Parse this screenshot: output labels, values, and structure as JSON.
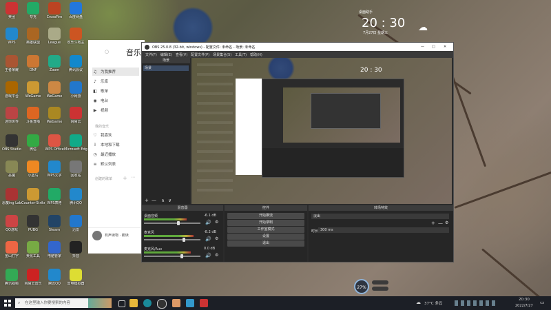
{
  "desktop": {
    "icons": [
      {
        "label": "美团",
        "color": "#c33"
      },
      {
        "label": "夸克",
        "color": "#2a6"
      },
      {
        "label": "CrossFire",
        "color": "#b42"
      },
      {
        "label": "百度网盘",
        "color": "#27d"
      },
      {
        "label": "WPS",
        "color": "#28c"
      },
      {
        "label": "英雄联盟",
        "color": "#a62"
      },
      {
        "label": "League",
        "color": "#aa8"
      },
      {
        "label": "欢乐斗地主",
        "color": "#c52"
      },
      {
        "label": "王者荣耀",
        "color": "#a53"
      },
      {
        "label": "DNF",
        "color": "#c73"
      },
      {
        "label": "Zoom",
        "color": "#2a8"
      },
      {
        "label": "腾讯会议",
        "color": "#18c"
      },
      {
        "label": "游戏平台",
        "color": "#a60"
      },
      {
        "label": "WeGame",
        "color": "#c93"
      },
      {
        "label": "WeGame",
        "color": "#c84"
      },
      {
        "label": "小网游",
        "color": "#27c"
      },
      {
        "label": "迷你世界",
        "color": "#b44"
      },
      {
        "label": "斗鱼直播",
        "color": "#d62"
      },
      {
        "label": "WeGame",
        "color": "#a82"
      },
      {
        "label": "网易云",
        "color": "#c33"
      },
      {
        "label": "OBS Studio",
        "color": "#333"
      },
      {
        "label": "微信",
        "color": "#3a4"
      },
      {
        "label": "WPS Office",
        "color": "#d54"
      },
      {
        "label": "Microsoft Edge",
        "color": "#1a8"
      },
      {
        "label": "恶魔",
        "color": "#885"
      },
      {
        "label": "小蓝鸟",
        "color": "#e82"
      },
      {
        "label": "WPS文字",
        "color": "#28c"
      },
      {
        "label": "回收站",
        "color": "#777"
      },
      {
        "label": "恶魔ing Lab",
        "color": "#a33"
      },
      {
        "label": "Counter-Strike",
        "color": "#c93"
      },
      {
        "label": "WPS表格",
        "color": "#2a6"
      },
      {
        "label": "腾讯QQ",
        "color": "#28c"
      },
      {
        "label": "QQ游戏",
        "color": "#c44"
      },
      {
        "label": "PUBG",
        "color": "#333"
      },
      {
        "label": "Steam",
        "color": "#246"
      },
      {
        "label": "迅雷",
        "color": "#27c"
      },
      {
        "label": "金山打字",
        "color": "#e64"
      },
      {
        "label": "美化工具",
        "color": "#7a4"
      },
      {
        "label": "电脑管家",
        "color": "#36c"
      },
      {
        "label": "抖音",
        "color": "#222"
      },
      {
        "label": "腾讯视频",
        "color": "#3a5"
      },
      {
        "label": "网易云音乐",
        "color": "#c22"
      },
      {
        "label": "腾讯QQ",
        "color": "#28c"
      },
      {
        "label": "雷电模拟器",
        "color": "#dd3"
      }
    ]
  },
  "widget": {
    "header": "桌面助手",
    "time": "20 : 30",
    "date": "7月27日 星期三"
  },
  "music": {
    "title": "音乐",
    "menu": [
      {
        "icon": "♫",
        "label": "为我推荐"
      },
      {
        "icon": "♪",
        "label": "乐库"
      },
      {
        "icon": "◧",
        "label": "歌单"
      },
      {
        "icon": "◉",
        "label": "电台"
      },
      {
        "icon": "▶",
        "label": "视频"
      }
    ],
    "section1": "我的音乐",
    "menu2": [
      {
        "icon": "♡",
        "label": "我喜欢"
      },
      {
        "icon": "⇩",
        "label": "本地和下载"
      },
      {
        "icon": "◷",
        "label": "最近播放"
      },
      {
        "icon": "≡",
        "label": "默认列表"
      }
    ],
    "section2": "创建的歌单",
    "now_playing": "有声读物 · 朗读"
  },
  "obs": {
    "title": "OBS 25.0.8 (32-bit, windows) - 配置文件: 未命名 - 场景: 未命名",
    "menu": [
      "文件(F)",
      "编辑(E)",
      "查看(V)",
      "配置文件(P)",
      "场景集合(S)",
      "工具(T)",
      "帮助(H)"
    ],
    "scenes_title": "场景",
    "scene_item": "场景",
    "mixer_title": "混音器",
    "mixer": [
      {
        "name": "桌面音频",
        "db": "-6.1 dB",
        "fill": 0.62
      },
      {
        "name": "麦克风",
        "db": "-8.2 dB",
        "fill": 0.72
      },
      {
        "name": "麦克风/Aux",
        "db": "0.0 dB",
        "fill": 0.68
      }
    ],
    "controls_title": "控件",
    "controls": [
      "开始推流",
      "开始录制",
      "工作室模式",
      "设置",
      "退出"
    ],
    "transitions_title": "转场特效",
    "transition": "淡出",
    "duration_label": "时长",
    "duration_value": "300 ms"
  },
  "taskbar": {
    "search_placeholder": "在这里输入你要搜索的内容",
    "weather": "37°C 多云",
    "time": "20:30",
    "date": "2022/7/27"
  },
  "perf": {
    "cpu": "27%"
  }
}
